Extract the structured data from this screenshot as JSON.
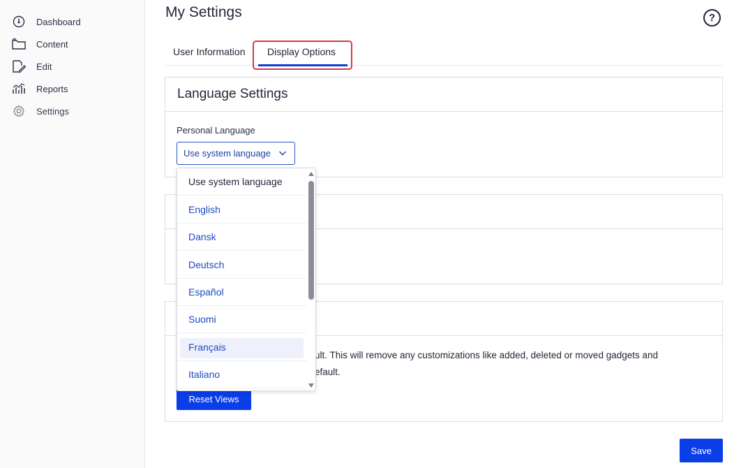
{
  "sidebar": {
    "items": [
      {
        "label": "Dashboard",
        "icon": "dashboard-icon"
      },
      {
        "label": "Content",
        "icon": "folder-icon"
      },
      {
        "label": "Edit",
        "icon": "edit-icon"
      },
      {
        "label": "Reports",
        "icon": "reports-icon"
      },
      {
        "label": "Settings",
        "icon": "gear-icon"
      }
    ]
  },
  "header": {
    "title": "My Settings",
    "help_glyph": "?"
  },
  "tabs": [
    {
      "label": "User Information",
      "active": false
    },
    {
      "label": "Display Options",
      "active": true
    }
  ],
  "language_card": {
    "title": "Language Settings",
    "field_label": "Personal Language",
    "selected_value": "Use system language"
  },
  "dropdown": {
    "options": [
      "Use system language",
      "English",
      "Dansk",
      "Deutsch",
      "Español",
      "Suomi",
      "Français",
      "Italiano"
    ],
    "hovered": "Français"
  },
  "reset_card": {
    "text_line1": "ult. This will remove any customizations like added, deleted or moved gadgets and",
    "text_line2": "efault.",
    "button_label": "Reset Views"
  },
  "footer": {
    "save_label": "Save"
  },
  "colors": {
    "accent": "#0a3ee8",
    "highlight_border": "#d63a3a",
    "link": "#1e4ac2"
  }
}
